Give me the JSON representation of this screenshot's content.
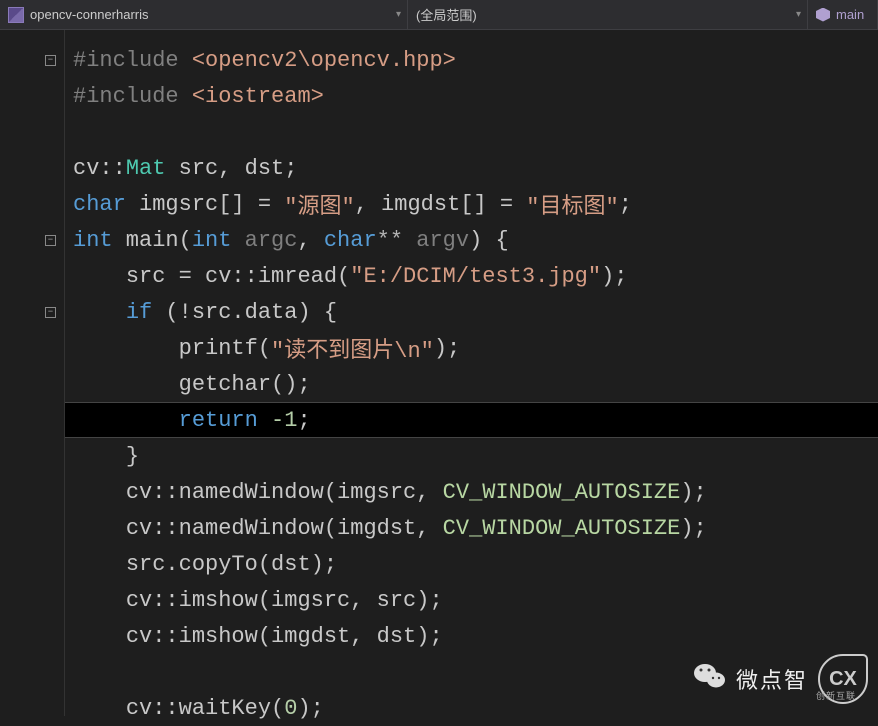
{
  "topbar": {
    "project": "opencv-connerharris",
    "scope": "(全局范围)",
    "member": "main"
  },
  "code": {
    "l1": {
      "directive": "#include ",
      "value": "<opencv2\\opencv.hpp>"
    },
    "l2": {
      "directive": "#include ",
      "value": "<iostream>"
    },
    "l4": {
      "ns": "cv::",
      "type": "Mat",
      "rest": " src, dst;"
    },
    "l5": {
      "kw": "char",
      "rest1": " imgsrc[] = ",
      "s1": "\"源图\"",
      "rest2": ", imgdst[] = ",
      "s2": "\"目标图\"",
      "rest3": ";"
    },
    "l6": {
      "kw1": "int",
      "fn": " main(",
      "kw2": "int",
      "p1": " argc",
      "c": ", ",
      "kw3": "char",
      "op": "**",
      "p2": " argv",
      "end": ") {"
    },
    "l7": {
      "ind": "    ",
      "rest": "src = cv::imread(",
      "s": "\"E:/DCIM/test3.jpg\"",
      "end": ");"
    },
    "l8": {
      "ind": "    ",
      "kw": "if",
      "rest": " (!src.data) {"
    },
    "l9": {
      "ind": "        ",
      "fn": "printf(",
      "s": "\"读不到图片\\n\"",
      "end": ");"
    },
    "l10": {
      "ind": "        ",
      "rest": "getchar();"
    },
    "l11": {
      "ind": "        ",
      "kw": "return",
      "sp": " ",
      "num": "-1",
      "end": ";"
    },
    "l12": {
      "ind": "    ",
      "rest": "}"
    },
    "l13": {
      "ind": "    ",
      "rest": "cv::namedWindow(imgsrc, ",
      "enum": "CV_WINDOW_AUTOSIZE",
      "end": ");"
    },
    "l14": {
      "ind": "    ",
      "rest": "cv::namedWindow(imgdst, ",
      "enum": "CV_WINDOW_AUTOSIZE",
      "end": ");"
    },
    "l15": {
      "ind": "    ",
      "rest": "src.copyTo(dst);"
    },
    "l16": {
      "ind": "    ",
      "rest": "cv::imshow(imgsrc, src);"
    },
    "l17": {
      "ind": "    ",
      "rest": "cv::imshow(imgdst, dst);"
    },
    "l19": {
      "ind": "    ",
      "rest": "cv::waitKey(",
      "num": "0",
      "end": ");"
    }
  },
  "watermark": {
    "text": "微点智",
    "logo": "CX",
    "sub": "创新互联"
  }
}
